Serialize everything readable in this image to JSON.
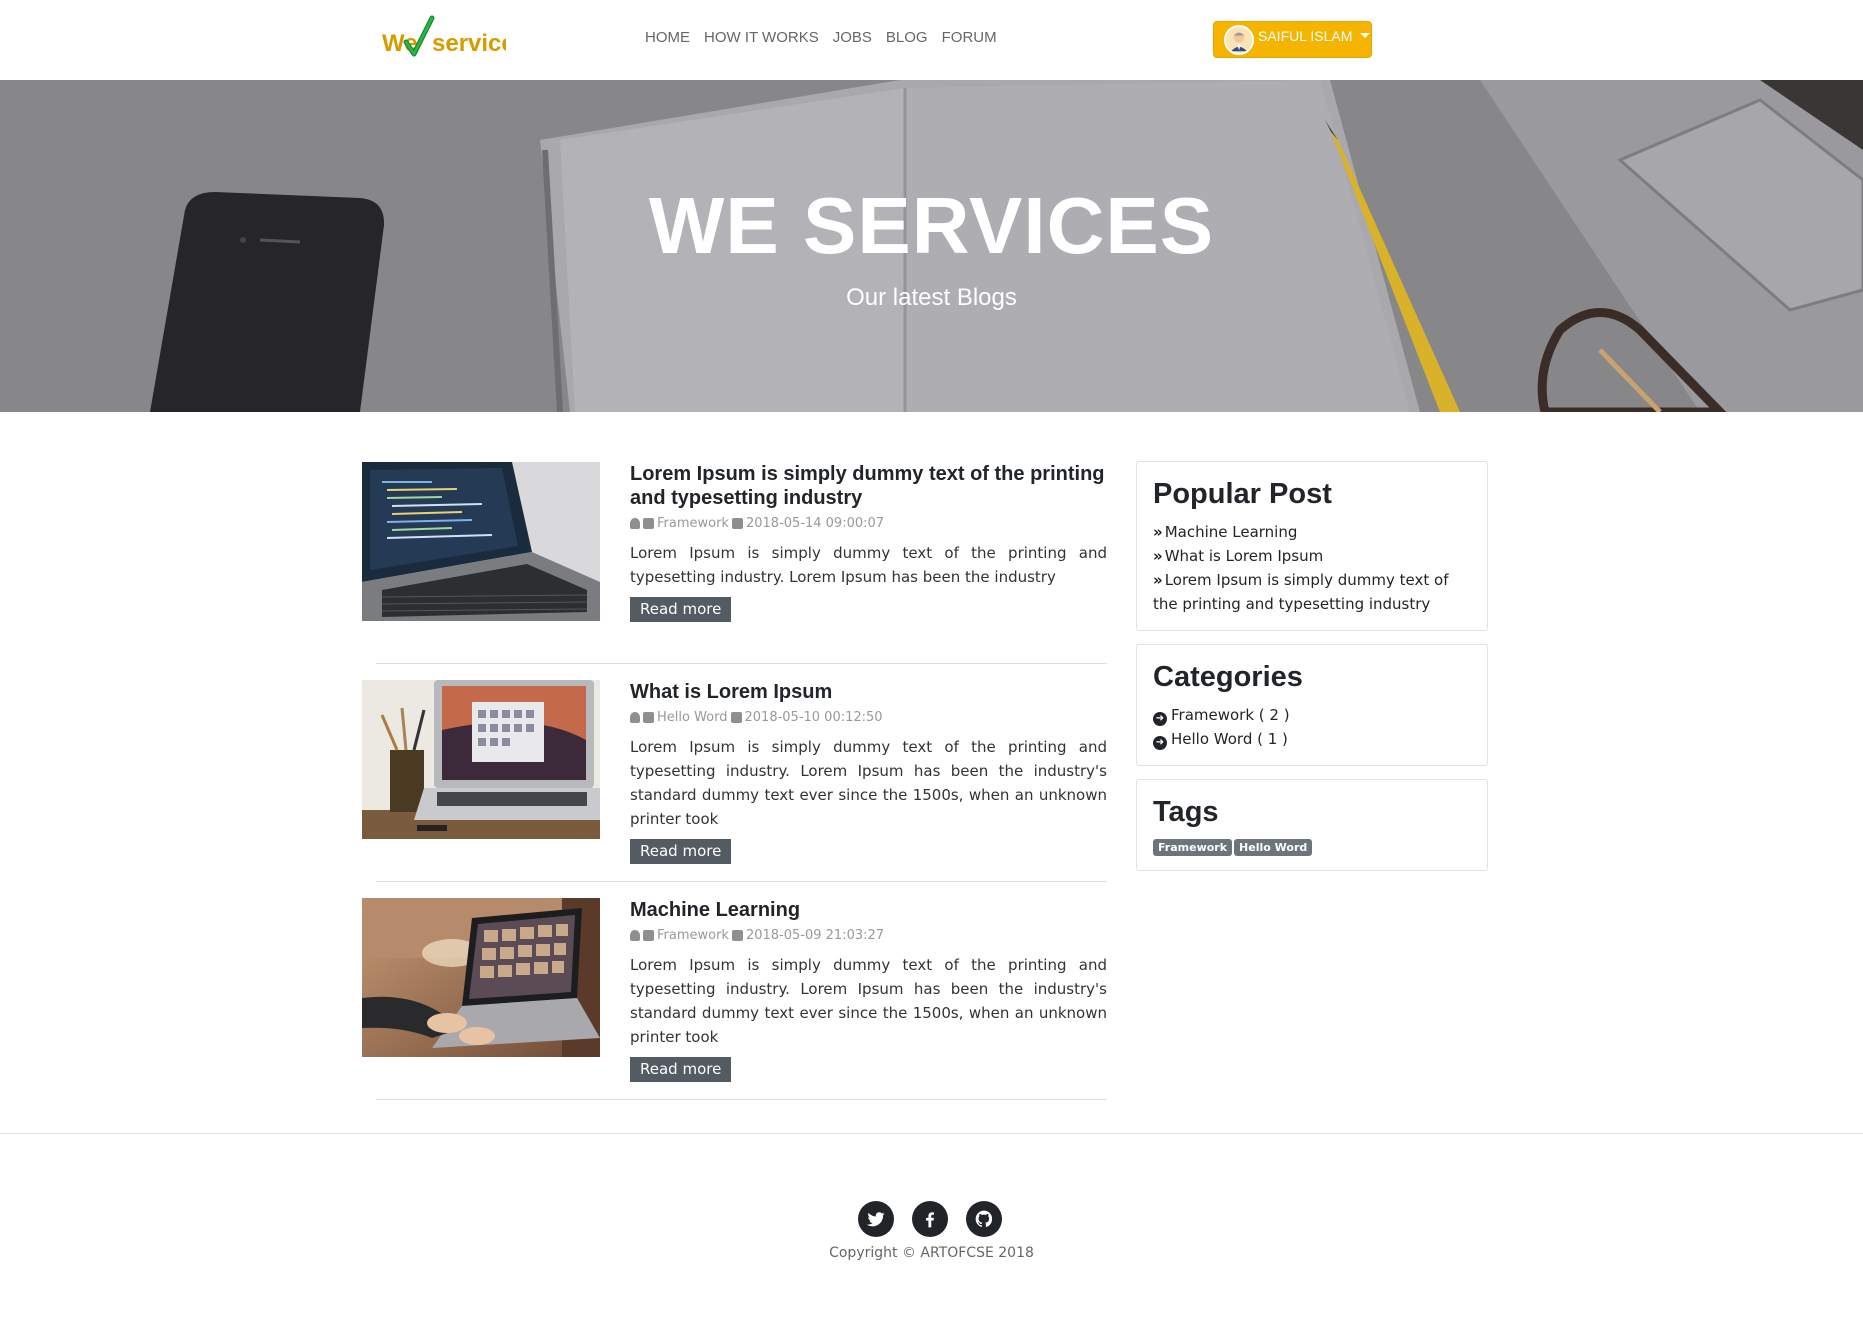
{
  "brand": {
    "logo_text_1": "We",
    "logo_text_2": "services",
    "accent": "#f5b400"
  },
  "nav": {
    "links": [
      "HOME",
      "HOW IT WORKS",
      "JOBS",
      "BLOG",
      "FORUM"
    ],
    "user": {
      "name": "SAIFUL ISLAM",
      "avatar_icon": "avatar-icon"
    }
  },
  "hero": {
    "title": "WE SERVICES",
    "subtitle": "Our latest Blogs"
  },
  "posts": [
    {
      "title": "Lorem Ipsum is simply dummy text of the printing and typesetting industry",
      "category": "Framework",
      "date": "2018-05-14 09:00:07",
      "excerpt": "Lorem Ipsum is simply dummy text of the printing and typesetting industry. Lorem Ipsum has been the industry",
      "read_more": "Read more",
      "image": "laptop-code-photo"
    },
    {
      "title": "What is Lorem Ipsum",
      "category": "Hello Word",
      "date": "2018-05-10 00:12:50",
      "excerpt": "Lorem Ipsum is simply dummy text of the printing and typesetting industry. Lorem Ipsum has been the industry's standard dummy text ever since the 1500s, when an unknown printer took",
      "read_more": "Read more",
      "image": "macbook-desk-photo"
    },
    {
      "title": "Machine Learning",
      "category": "Framework",
      "date": "2018-05-09 21:03:27",
      "excerpt": "Lorem Ipsum is simply dummy text of the printing and typesetting industry. Lorem Ipsum has been the industry's standard dummy text ever since the 1500s, when an unknown printer took",
      "read_more": "Read more",
      "image": "typing-laptop-photo"
    }
  ],
  "sidebar": {
    "popular": {
      "heading": "Popular Post",
      "items": [
        "Machine Learning",
        "What is Lorem Ipsum",
        "Lorem Ipsum is simply dummy text of the printing and typesetting industry"
      ]
    },
    "categories": {
      "heading": "Categories",
      "items": [
        "Framework ( 2 )",
        "Hello Word ( 1 )"
      ]
    },
    "tags": {
      "heading": "Tags",
      "items": [
        "Framework",
        "Hello Word"
      ]
    }
  },
  "footer": {
    "social": [
      "twitter-icon",
      "facebook-icon",
      "github-icon"
    ],
    "copyright": "Copyright © ARTOFCSE 2018"
  }
}
